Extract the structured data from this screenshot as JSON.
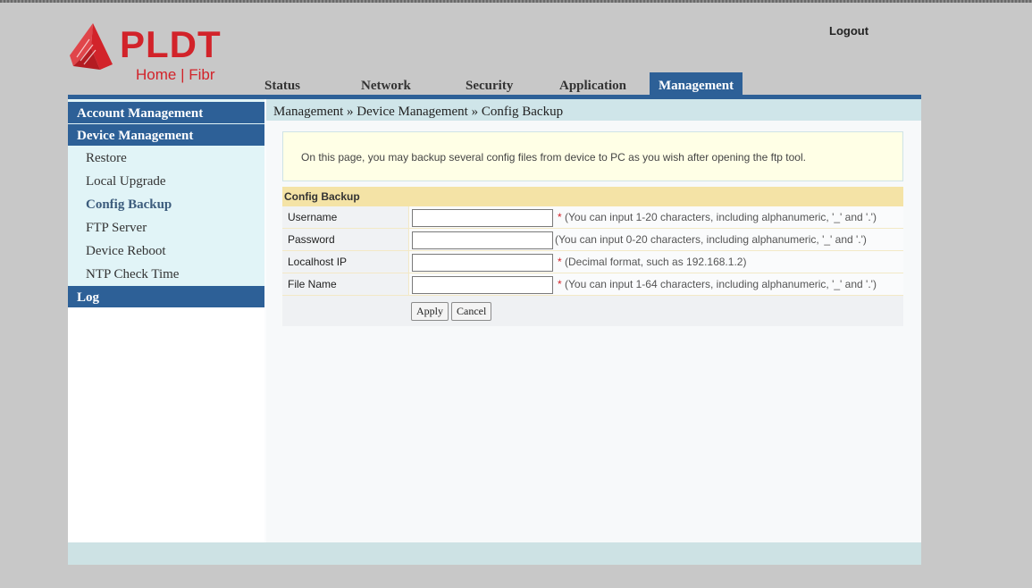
{
  "header": {
    "logo_text": "PLDT",
    "logo_sub": "Home | Fibr",
    "logout_label": "Logout"
  },
  "nav": {
    "tabs": [
      {
        "label": "Status"
      },
      {
        "label": "Network"
      },
      {
        "label": "Security"
      },
      {
        "label": "Application"
      },
      {
        "label": "Management"
      }
    ],
    "active": "Management"
  },
  "sidebar": {
    "sections": [
      {
        "label": "Account Management"
      },
      {
        "label": "Device Management"
      },
      {
        "label": "Log"
      }
    ],
    "items": [
      {
        "label": "Restore"
      },
      {
        "label": "Local Upgrade"
      },
      {
        "label": "Config Backup"
      },
      {
        "label": "FTP Server"
      },
      {
        "label": "Device Reboot"
      },
      {
        "label": "NTP Check Time"
      }
    ],
    "current": "Config Backup"
  },
  "breadcrumb": "Management » Device Management » Config Backup",
  "info_text": "On this page, you may backup several config files from device to PC as you wish after opening the ftp tool.",
  "form": {
    "title": "Config Backup",
    "fields": [
      {
        "label": "Username",
        "value": "",
        "required": "*",
        "hint": "(You can input 1-20 characters, including alphanumeric, '_' and '.')"
      },
      {
        "label": "Password",
        "value": "",
        "required": "",
        "hint": "(You can input 0-20 characters, including alphanumeric, '_' and '.')"
      },
      {
        "label": "Localhost IP",
        "value": "",
        "required": "*",
        "hint": "(Decimal format, such as 192.168.1.2)"
      },
      {
        "label": "File Name",
        "value": "",
        "required": "*",
        "hint": "(You can input 1-64 characters, including alphanumeric, '_' and '.')"
      }
    ],
    "apply_label": "Apply",
    "cancel_label": "Cancel"
  },
  "colors": {
    "brand_red": "#d2232a",
    "nav_blue": "#2d6097",
    "sidebar_bg": "#e1f4f7",
    "form_header": "#f4e3a6"
  }
}
